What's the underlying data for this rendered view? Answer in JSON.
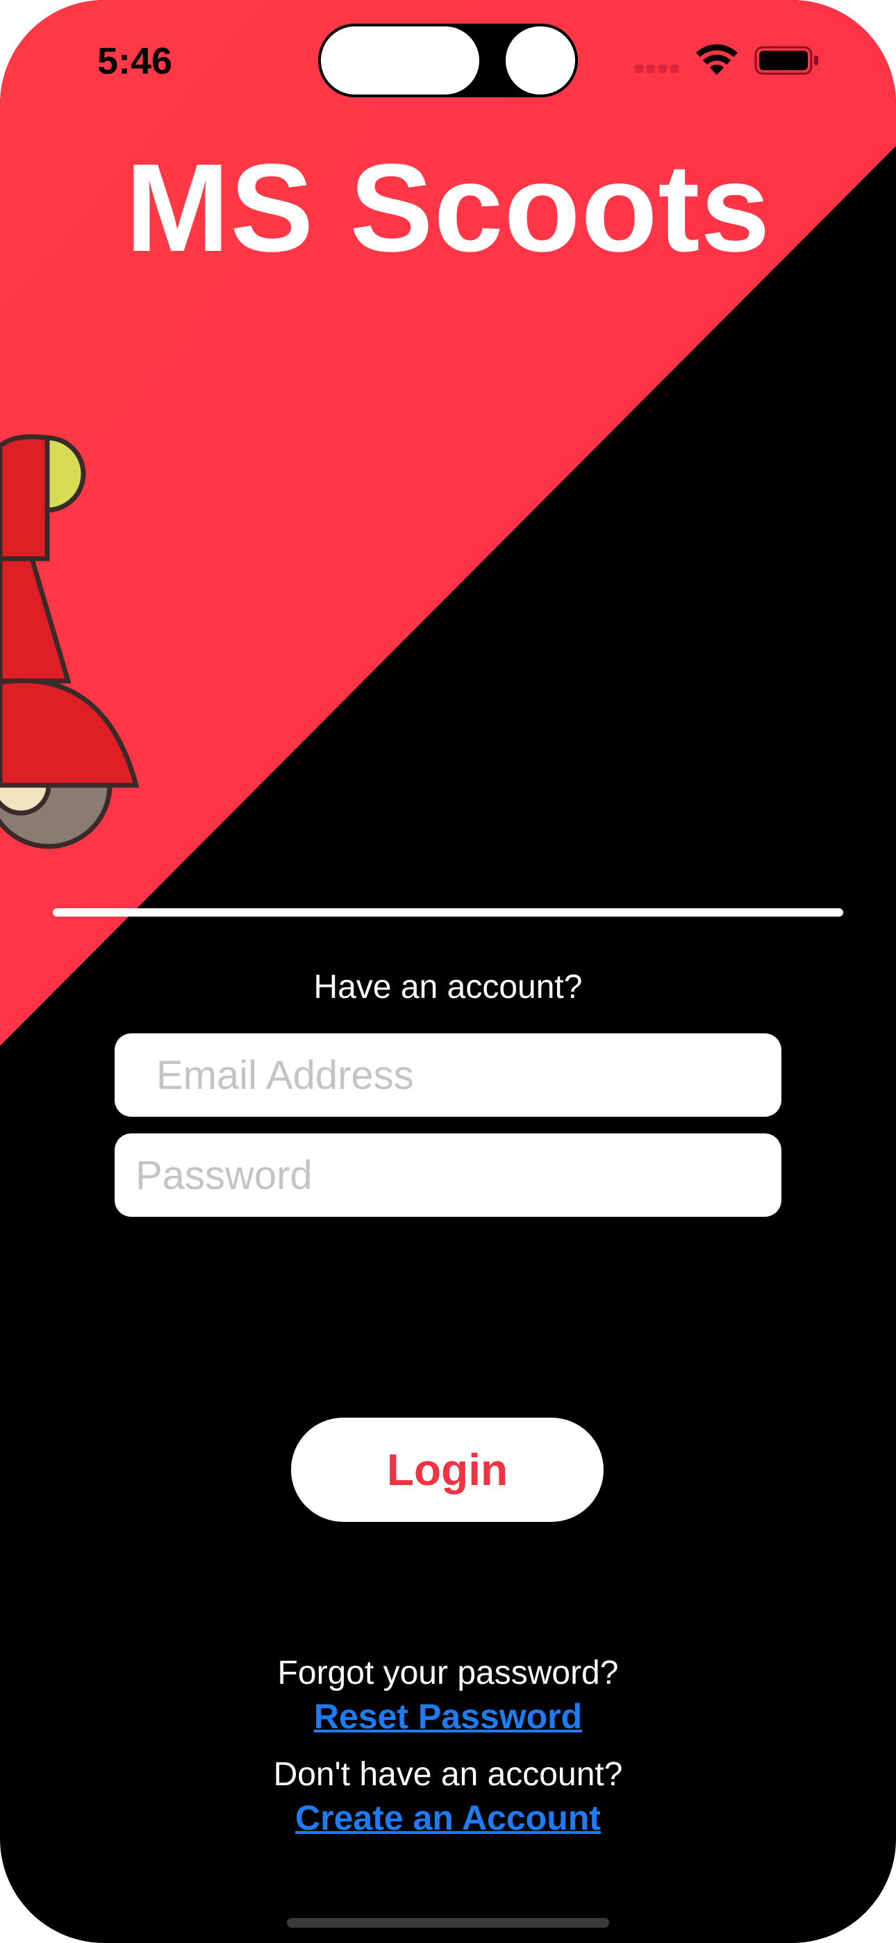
{
  "status_bar": {
    "time": "5:46",
    "wifi_icon": "wifi-icon",
    "battery_icon": "battery-icon",
    "signal_icon": "cellular-signal-icon"
  },
  "app": {
    "title": "MS Scoots",
    "brand_red": "#ef3340",
    "background": "#000000",
    "illustration": "scooter-illustration"
  },
  "login_form": {
    "prompt": "Have an account?",
    "email_placeholder": "Email Address",
    "email_value": "",
    "password_placeholder": "Password",
    "password_value": "",
    "login_label": "Login"
  },
  "links": {
    "forgot_text": "Forgot your password?",
    "reset_label": "Reset Password",
    "no_account_text": "Don't have an account?",
    "create_label": "Create an Account",
    "link_color": "#1e7bf2"
  }
}
